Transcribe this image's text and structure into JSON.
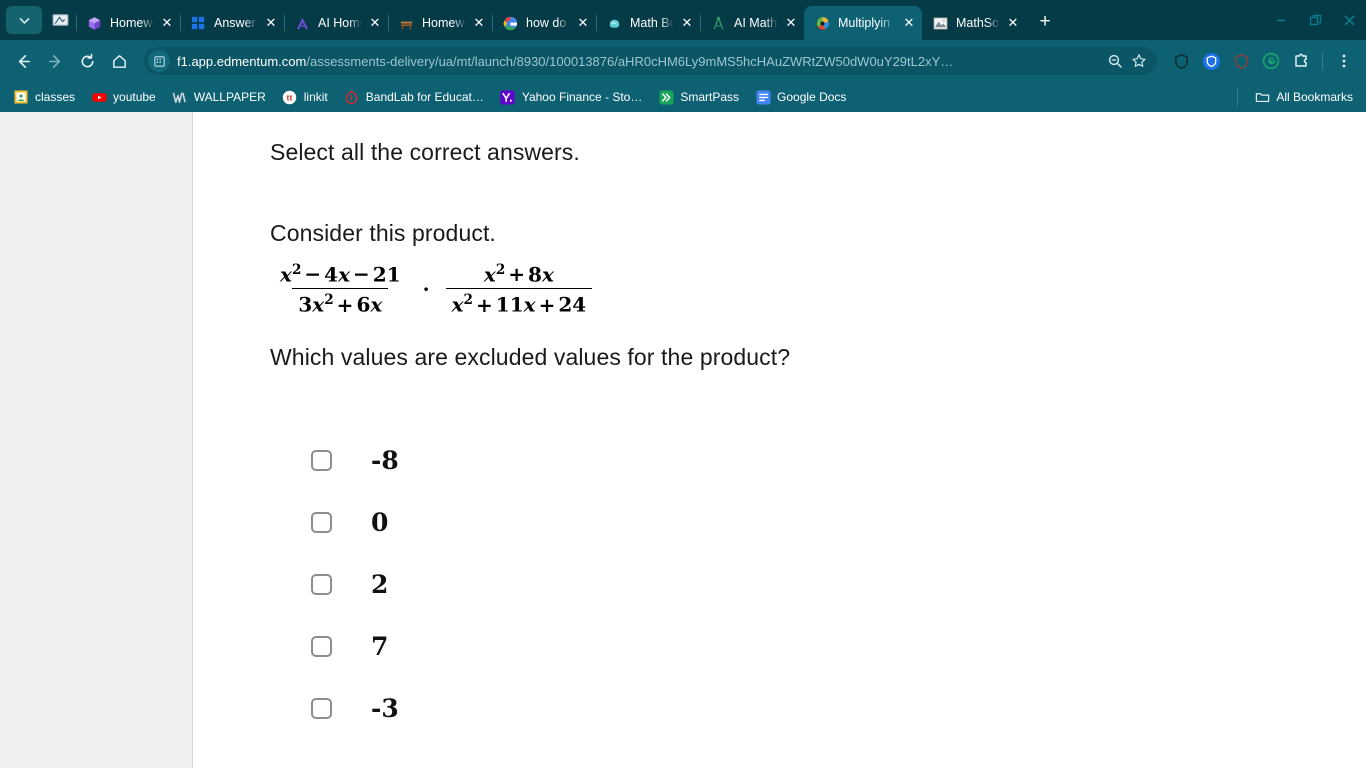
{
  "window": {
    "panel_toggle_icon": "chevron-down-icon",
    "minimize_label": "—",
    "restore_label": "❐",
    "close_label": "✕"
  },
  "tabs": {
    "new_tab_label": "+",
    "close_label": "✕",
    "items": [
      {
        "title": "Homework",
        "favicon": "purple-cube-icon",
        "active": false
      },
      {
        "title": "Answer - S",
        "favicon": "blue-blocks-icon",
        "active": false
      },
      {
        "title": "AI Homew",
        "favicon": "triangle-a-icon",
        "active": false
      },
      {
        "title": "Homework",
        "favicon": "bench-icon",
        "active": false
      },
      {
        "title": "how do y",
        "favicon": "google-g-icon",
        "active": false
      },
      {
        "title": "Math Bot",
        "favicon": "muscle-arm-icon",
        "active": false
      },
      {
        "title": "AI Math G",
        "favicon": "compass-icon",
        "active": false
      },
      {
        "title": "Multiplyin",
        "favicon": "color-wheel-icon",
        "active": true
      },
      {
        "title": "MathSolv",
        "favicon": "photo-icon",
        "active": false
      }
    ]
  },
  "navigation": {
    "back_icon": "back-arrow-icon",
    "forward_icon": "forward-arrow-icon",
    "reload_icon": "reload-icon",
    "home_icon": "home-icon",
    "site_badge_icon": "building-icon",
    "zoom_icon": "zoom-out-icon",
    "bookmark_icon": "star-icon"
  },
  "address": {
    "host": "f1.app.edmentum.com",
    "path": "/assessments-delivery/ua/mt/launch/8930/100013876/aHR0cHM6Ly9mMS5hcHAuZWRtZW50dW0uY29tL2xY…"
  },
  "extensions": [
    {
      "name": "shield-outline-icon"
    },
    {
      "name": "shield-blue-badge-icon"
    },
    {
      "name": "shield-red-icon"
    },
    {
      "name": "grammarly-g-icon"
    },
    {
      "name": "puzzle-extensions-icon"
    },
    {
      "name": "kebab-menu-icon"
    }
  ],
  "bookmarks": {
    "items": [
      {
        "label": "classes",
        "favicon": "classroom-icon"
      },
      {
        "label": "youtube",
        "favicon": "youtube-icon"
      },
      {
        "label": "WALLPAPER",
        "favicon": "wallpaper-w-icon"
      },
      {
        "label": "linkit",
        "favicon": "linkit-icon"
      },
      {
        "label": "BandLab for Educat…",
        "favicon": "bandlab-icon"
      },
      {
        "label": "Yahoo Finance - Sto…",
        "favicon": "yahoo-icon"
      },
      {
        "label": "SmartPass",
        "favicon": "smartpass-icon"
      },
      {
        "label": "Google Docs",
        "favicon": "google-docs-icon"
      }
    ],
    "all_bookmarks_label": "All Bookmarks",
    "all_bookmarks_icon": "folder-icon"
  },
  "question": {
    "instruction": "Select all the correct answers.",
    "prompt": "Consider this product.",
    "sub_question": "Which values are excluded values for the product?",
    "expression": {
      "left": {
        "numerator": {
          "var": "x",
          "exp": "2",
          "t2op": "−",
          "t2": "4",
          "t2var": "x",
          "t3op": "−",
          "t3": "21"
        },
        "denominator": {
          "coef": "3",
          "var": "x",
          "exp": "2",
          "op": "+",
          "t2": "6",
          "t2var": "x"
        }
      },
      "operator": "·",
      "right": {
        "numerator": {
          "var": "x",
          "exp": "2",
          "op": "+",
          "t2": "8",
          "t2var": "x"
        },
        "denominator": {
          "var": "x",
          "exp": "2",
          "op": "+",
          "t2": "11",
          "t2var": "x",
          "op2": "+",
          "t3": "24"
        }
      }
    },
    "options": [
      {
        "label": "-8",
        "checked": false
      },
      {
        "label": "0",
        "checked": false
      },
      {
        "label": "2",
        "checked": false
      },
      {
        "label": "7",
        "checked": false
      },
      {
        "label": "-3",
        "checked": false
      }
    ]
  },
  "colors": {
    "tabstrip_bg": "#053a47",
    "chrome_bg": "#0d6173",
    "active_tab_bg": "#0d6173",
    "urlbar_bg": "#0a5566",
    "page_bg": "#ffffff",
    "rail_bg": "#f0f0f0",
    "text_dark": "#1a1a1a",
    "checkbox_border": "#8d8d8d"
  }
}
